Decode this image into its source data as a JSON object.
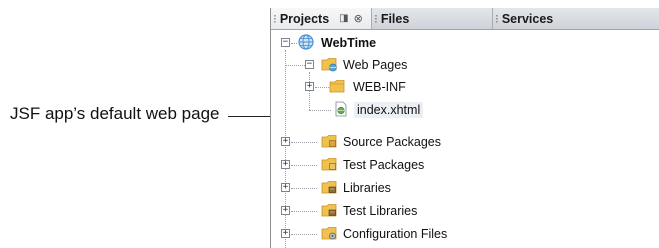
{
  "callout": {
    "text": "JSF app’s default web page"
  },
  "tabs": [
    {
      "label": "Projects",
      "active": true
    },
    {
      "label": "Files",
      "active": false
    },
    {
      "label": "Services",
      "active": false
    }
  ],
  "tab_controls": {
    "minimize": "◨",
    "close": "⊗"
  },
  "tree": {
    "project": {
      "label": "WebTime",
      "icon": "globe-icon",
      "expanded": true
    },
    "web_pages": {
      "label": "Web Pages",
      "icon": "web-folder-icon",
      "expanded": true
    },
    "web_inf": {
      "label": "WEB-INF",
      "icon": "folder-icon",
      "expanded": false
    },
    "index": {
      "label": "index.xhtml",
      "icon": "xhtml-file-icon"
    },
    "items": [
      {
        "label": "Source Packages",
        "icon": "package-folder-icon"
      },
      {
        "label": "Test Packages",
        "icon": "test-package-folder-icon"
      },
      {
        "label": "Libraries",
        "icon": "libraries-icon"
      },
      {
        "label": "Test Libraries",
        "icon": "test-libraries-icon"
      },
      {
        "label": "Configuration Files",
        "icon": "config-folder-icon"
      }
    ]
  },
  "colors": {
    "folder": "#f0c24b",
    "folder_dark": "#c9922a",
    "globe": "#4a8fd1",
    "selection": "#eceff3"
  }
}
